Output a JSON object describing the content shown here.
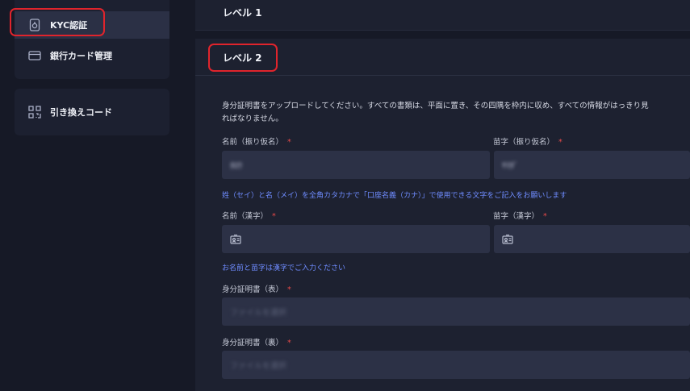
{
  "sidebar": {
    "items": [
      {
        "label": "KYC認証",
        "icon": "camera-icon",
        "active": true
      },
      {
        "label": "銀行カード管理",
        "icon": "card-icon",
        "active": false
      }
    ],
    "redeem": {
      "label": "引き換えコード",
      "icon": "qr-code-icon"
    }
  },
  "main": {
    "level1": {
      "title": "レベル 1"
    },
    "level2": {
      "title": "レベル 2",
      "description_line1": "身分証明書をアップロードしてください。すべての書類は、平面に置き、その四隅を枠内に収め、すべての情報がはっきり見",
      "description_line2": "ればなりません。",
      "first_name_kana": {
        "label": "名前（振り仮名）",
        "required_mark": "*",
        "value": "ﾀﾛｳ"
      },
      "last_name_kana": {
        "label": "苗字（振り仮名）",
        "required_mark": "*",
        "value": "ﾔﾏﾀﾞ"
      },
      "kana_hint": "姓（セイ）と名（メイ）を全角カタカナで「口座名義（カナ）」で使用できる文字をご記入をお願いします",
      "first_name_kanji": {
        "label": "名前（漢字）",
        "required_mark": "*",
        "value": ""
      },
      "last_name_kanji": {
        "label": "苗字（漢字）",
        "required_mark": "*",
        "value": ""
      },
      "kanji_hint": "お名前と苗字は漢字でご入力ください",
      "id_front": {
        "label": "身分証明書（表）",
        "required_mark": "*",
        "placeholder": "ファイルを選択"
      },
      "id_back": {
        "label": "身分証明書（裏）",
        "required_mark": "*",
        "placeholder": "ファイルを選択"
      }
    }
  },
  "colors": {
    "accent_link": "#6f8cff",
    "required": "#e84a4a",
    "highlight": "#e0242c"
  }
}
